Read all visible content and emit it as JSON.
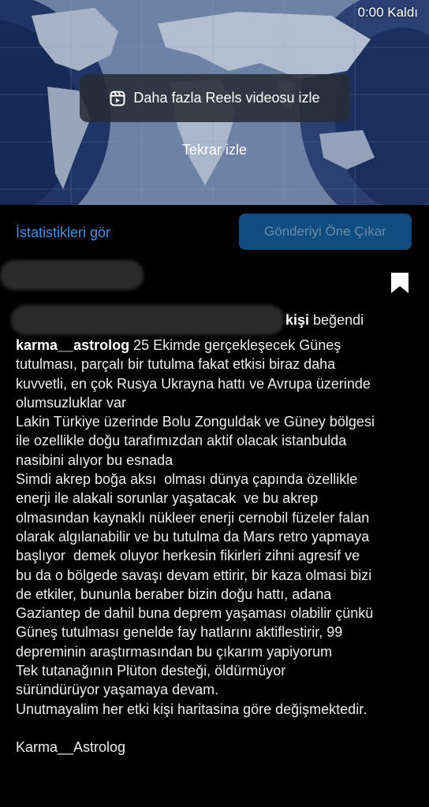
{
  "video": {
    "time_remaining": "0:00 Kaldı",
    "more_reels_label": "Daha fazla Reels videosu izle",
    "replay_label": "Tekrar izle"
  },
  "actions": {
    "stats_link": "İstatistikleri gör",
    "boost_button": "Gönderiyi Öne Çıkar"
  },
  "likes": {
    "bold": "kişi",
    "rest": " beğendi"
  },
  "post": {
    "username": "karma__astrolog",
    "caption": "25 Ekimde gerçekleşecek Güneş\ntutulması, parçalı bir tutulma fakat etkisi biraz daha\nkuvvetli, en çok Rusya Ukrayna hattı ve Avrupa üzerinde\nolumsuzluklar var\nLakin Türkiye üzerinde Bolu Zonguldak ve Güney bölgesi\nile ozellikle doğu tarafımızdan aktif olacak istanbulda\nnasibini alıyor bu esnada\nSimdi akrep boğa aksı  olması dünya çapında özellikle\nenerji ile alakali sorunlar yaşatacak  ve bu akrep\nolmasından kaynaklı nükleer enerji cernobil füzeler falan\nolarak algılanabilir ve bu tutulma da Mars retro yapmaya\nbaşlıyor  demek oluyor herkesin fikirleri zihni agresif ve\nbu da o bölgede savaşı devam ettirir, bir kaza olmasi bizi\nde etkiler, bununla beraber bizin doğu hattı, adana\nGaziantep de dahil buna deprem yaşaması olabilir çünkü\nGüneş tutulması genelde fay hatlarını aktiflestirir, 99\ndepreminin araştırmasından bu çıkarım yapiyorum\nTek tutanağının Plüton desteği, öldürmüyor\nsüründürüyor yaşamaya devam.\nUnutmayalim her etki kişi haritasina göre değişmektedir.\n\nKarma__Astrolog"
  },
  "colors": {
    "background": "#000000",
    "link": "#3b93e8",
    "boost_bg": "#0f4d80",
    "boost_text": "#6d8aa6"
  },
  "icons": {
    "reels": "reels-icon",
    "bookmark": "bookmark-icon"
  }
}
